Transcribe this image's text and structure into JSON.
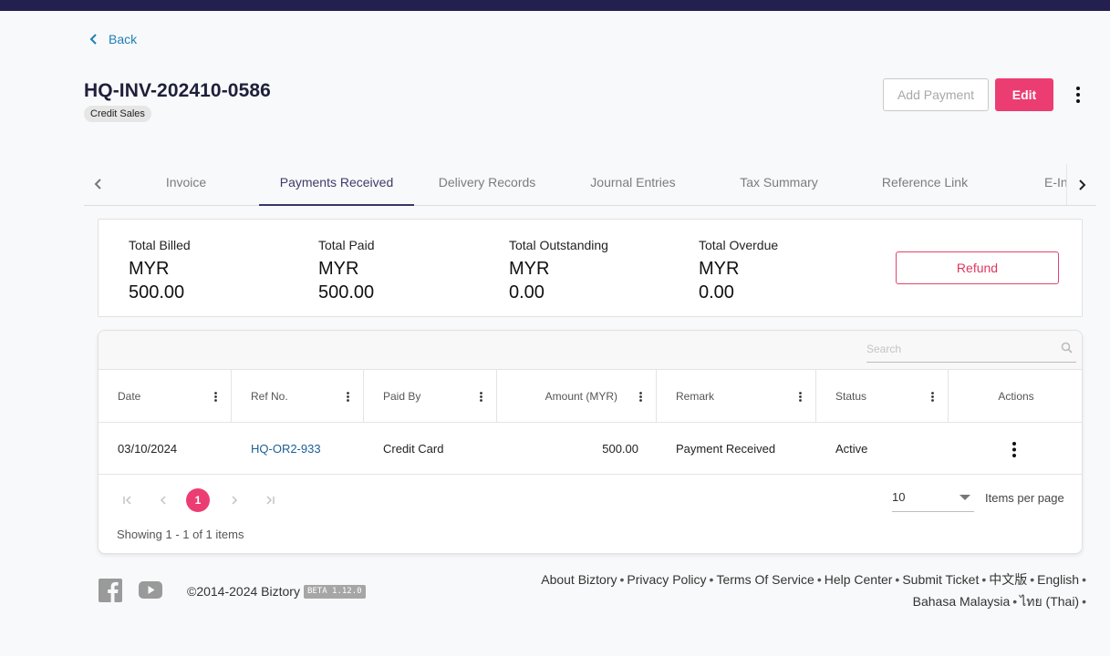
{
  "header": {
    "back_label": "Back"
  },
  "invoice": {
    "number": "HQ-INV-202410-0586",
    "type_badge": "Credit Sales",
    "add_payment_label": "Add Payment",
    "edit_label": "Edit"
  },
  "tabs": [
    {
      "label": "Invoice"
    },
    {
      "label": "Payments Received"
    },
    {
      "label": "Delivery Records"
    },
    {
      "label": "Journal Entries"
    },
    {
      "label": "Tax Summary"
    },
    {
      "label": "Reference Link"
    },
    {
      "label": "E-Invoice"
    }
  ],
  "active_tab": "Payments Received",
  "summary": {
    "total_billed": {
      "label": "Total Billed",
      "currency": "MYR",
      "amount": "500.00"
    },
    "total_paid": {
      "label": "Total Paid",
      "currency": "MYR",
      "amount": "500.00"
    },
    "total_outstanding": {
      "label": "Total Outstanding",
      "currency": "MYR",
      "amount": "0.00"
    },
    "total_overdue": {
      "label": "Total Overdue",
      "currency": "MYR",
      "amount": "0.00"
    },
    "refund_label": "Refund"
  },
  "grid": {
    "search_placeholder": "Search",
    "columns": {
      "date": "Date",
      "ref_no": "Ref No.",
      "paid_by": "Paid By",
      "amount": "Amount (MYR)",
      "remark": "Remark",
      "status": "Status",
      "actions": "Actions"
    },
    "rows": [
      {
        "date": "03/10/2024",
        "ref_no": "HQ-OR2-933",
        "paid_by": "Credit Card",
        "amount": "500.00",
        "remark": "Payment Received",
        "status": "Active"
      }
    ],
    "pager": {
      "current_page": "1",
      "page_size": "10",
      "items_per_page_label": "Items per page",
      "showing": "Showing 1 - 1 of 1 items"
    }
  },
  "footer": {
    "copyright": "©2014-2024 Biztory",
    "version_badge": "BETA 1.12.0",
    "links": [
      "About Biztory",
      "Privacy Policy",
      "Terms Of Service",
      "Help Center",
      "Submit Ticket",
      "中文版",
      "English",
      "Bahasa Malaysia",
      "ไทย (Thai)"
    ]
  },
  "colors": {
    "topbar": "#23204f",
    "primary_pink": "#ec3d72",
    "link_blue": "#1f7fb6",
    "active_tab": "#3a3564"
  }
}
